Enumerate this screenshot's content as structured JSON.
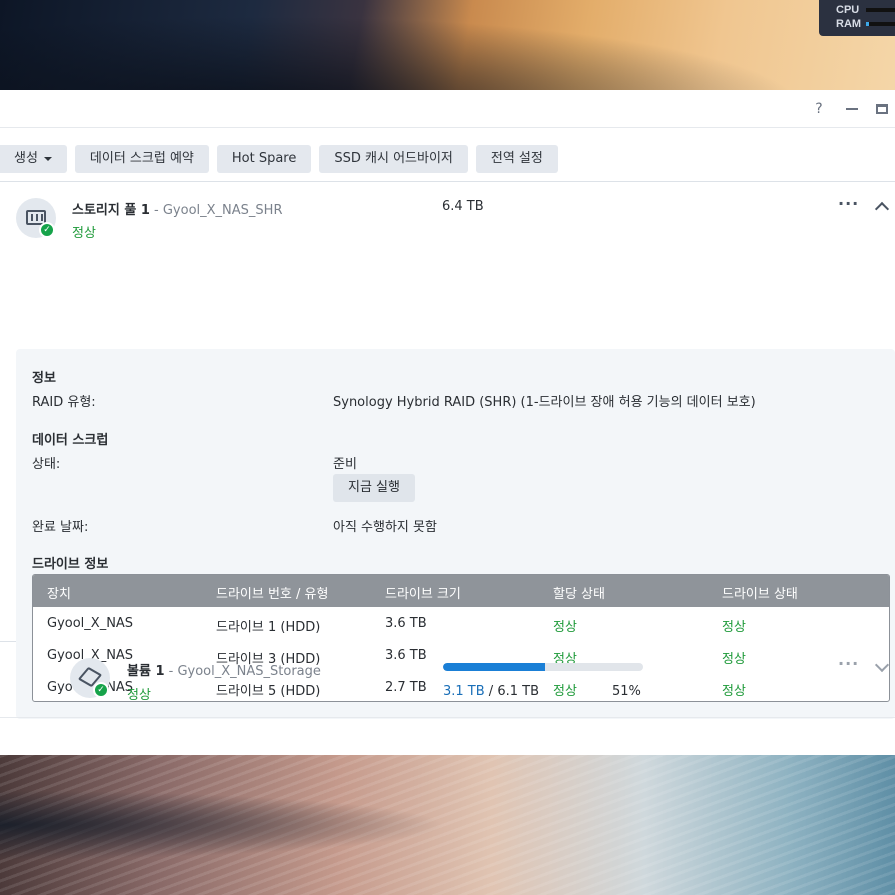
{
  "resources": {
    "cpu_label": "CPU",
    "ram_label": "RAM",
    "cpu_level": 0.0,
    "ram_level": 0.1
  },
  "window": {
    "help_icon": "?",
    "min_icon": "minimize-icon",
    "max_icon": "maximize-icon"
  },
  "toolbar": {
    "create_label": "생성",
    "scrub_schedule_label": "데이터 스크럽 예약",
    "hot_spare_label": "Hot Spare",
    "ssd_advisor_label": "SSD 캐시 어드바이저",
    "global_settings_label": "전역 설정"
  },
  "pool": {
    "name": "스토리지 풀 1",
    "sub": " - Gyool_X_NAS_SHR",
    "status": "정상",
    "size": "6.4 TB",
    "info_title": "정보",
    "raid_type_label": "RAID 유형:",
    "raid_type_value": "Synology Hybrid RAID (SHR) (1-드라이브 장애 허용 기능의 데이터 보호)",
    "scrub_title": "데이터 스크럽",
    "state_label": "상태:",
    "state_value": "준비",
    "run_now_label": "지금 실행",
    "completed_label": "완료 날짜:",
    "completed_value": "아직 수행하지 못함",
    "drive_info_title": "드라이브 정보",
    "table_headers": [
      "장치",
      "드라이브 번호 / 유형",
      "드라이브 크기",
      "할당 상태",
      "드라이브 상태"
    ],
    "drives": [
      {
        "device": "Gyool_X_NAS",
        "slot": "드라이브 1 (HDD)",
        "size": "3.6 TB",
        "alloc": "정상",
        "status": "정상"
      },
      {
        "device": "Gyool_X_NAS",
        "slot": "드라이브 3 (HDD)",
        "size": "3.6 TB",
        "alloc": "정상",
        "status": "정상"
      },
      {
        "device": "Gyool_X_NAS",
        "slot": "드라이브 5 (HDD)",
        "size": "2.7 TB",
        "alloc": "정상",
        "status": "정상"
      }
    ]
  },
  "volume": {
    "name": "볼륨 1",
    "sub": " - Gyool_X_NAS_Storage",
    "status": "정상",
    "used": "3.1 TB",
    "separator": " / ",
    "total": "6.1 TB",
    "percent_label": "51%",
    "usage_fraction": 0.51
  },
  "colors": {
    "status_ok": "#1f9a3a",
    "usage_fill": "#1a7fd6",
    "table_header": "#8f949a"
  }
}
